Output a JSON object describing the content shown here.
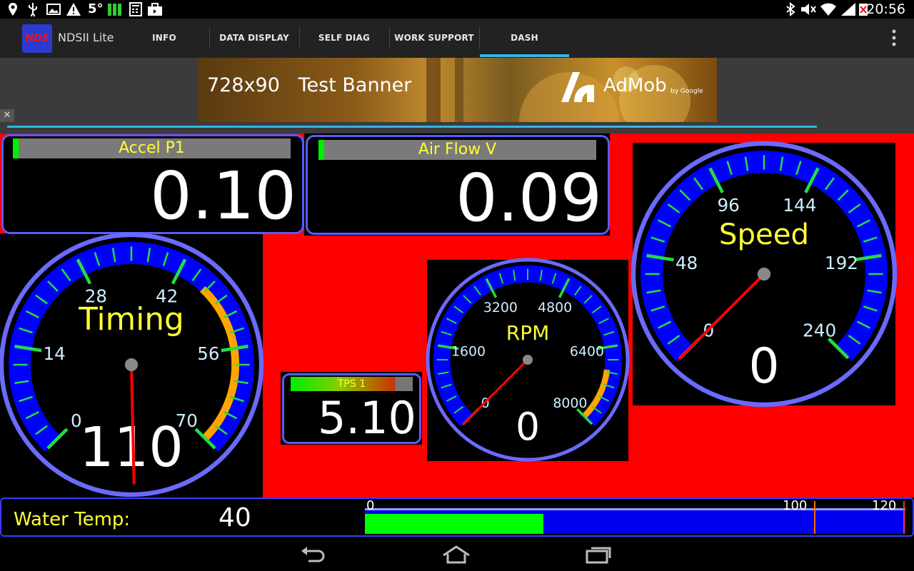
{
  "status_bar": {
    "temperature": "5°",
    "clock": "20:56",
    "left_icons": [
      "location-icon",
      "usb-icon",
      "image-icon",
      "warning-icon",
      "temperature-text",
      "signal-bars-icon",
      "calculator-icon",
      "briefcase-icon"
    ],
    "right_icons": [
      "bluetooth-icon",
      "mute-icon",
      "wifi-icon",
      "cell-signal-icon",
      "battery-icon"
    ]
  },
  "app": {
    "logo_text": "NDS",
    "title": "NDSII Lite"
  },
  "tabs": [
    {
      "label": "INFO"
    },
    {
      "label": "DATA DISPLAY"
    },
    {
      "label": "SELF DIAG"
    },
    {
      "label": "WORK SUPPORT"
    },
    {
      "label": "DASH",
      "selected": true
    }
  ],
  "ad": {
    "banner_text": "728x90   Test Banner",
    "brand": "AdMob",
    "by": "by Google",
    "close": "✕"
  },
  "dash": {
    "accel": {
      "title": "Accel P1",
      "value": "0.10",
      "bar_fraction": 0.02
    },
    "airflow": {
      "title": "Air Flow V",
      "value": "0.09",
      "bar_fraction": 0.02
    },
    "tps": {
      "title": "TPS 1",
      "value": "5.10"
    },
    "timing": {
      "title": "Timing",
      "value": "110",
      "ticks": [
        "0",
        "14",
        "28",
        "42",
        "56",
        "70"
      ],
      "min": 0,
      "max": 70,
      "needle": -12
    },
    "rpm": {
      "title": "RPM",
      "value": "0",
      "ticks": [
        "0",
        "1600",
        "3200",
        "4800",
        "6400",
        "8000"
      ],
      "min": 0,
      "max": 8000,
      "needle": 0
    },
    "speed": {
      "title": "Speed",
      "value": "0",
      "ticks": [
        "0",
        "48",
        "96",
        "144",
        "192",
        "240"
      ],
      "min": 0,
      "max": 240,
      "needle": 0
    },
    "water": {
      "label": "Water Temp:",
      "value": "40",
      "scale_min": "0",
      "scale_mid": "100",
      "scale_max": "120",
      "fraction": 0.33
    }
  },
  "colors": {
    "gauge_blue": "#0000ff",
    "gauge_rim": "#6a6aff",
    "warn_orange": "#ffa500",
    "needle": "#ff0000",
    "label_yellow": "#ffff33",
    "tick_text": "#cceeff"
  }
}
